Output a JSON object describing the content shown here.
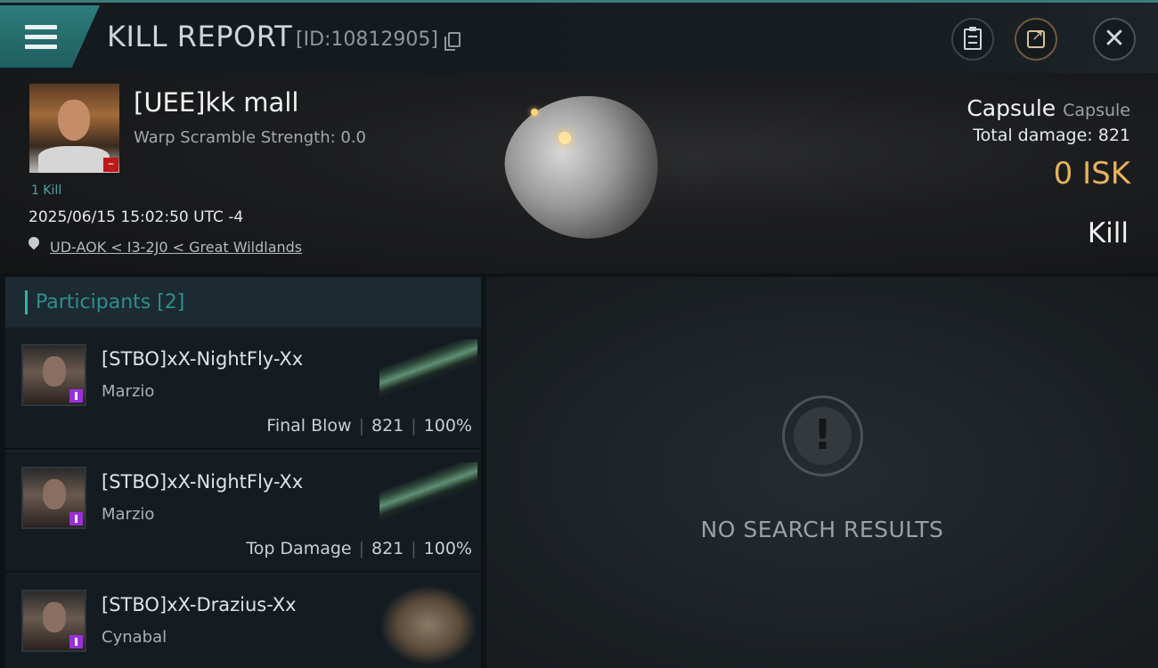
{
  "header": {
    "title": "KILL REPORT",
    "report_id": "[ID:10812905]"
  },
  "victim": {
    "name": "[UEE]kk mall",
    "warp_scramble": "Warp Scramble Strength: 0.0",
    "kill_count": "1 Kill",
    "timestamp": "2025/06/15 15:02:50 UTC -4",
    "location": "UD-AOK < I3-2J0 < Great Wildlands",
    "ship_type": "Capsule",
    "ship_class": "Capsule",
    "total_damage": "Total damage:  821",
    "isk_value": "0  ISK",
    "result": "Kill"
  },
  "participants": {
    "title": "Participants [2]",
    "items": [
      {
        "name": "[STBO]xX-NightFly-Xx",
        "corp": "Marzio",
        "role": "Final Blow",
        "damage": "821",
        "percent": "100%"
      },
      {
        "name": "[STBO]xX-NightFly-Xx",
        "corp": "Marzio",
        "role": "Top Damage",
        "damage": "821",
        "percent": "100%"
      },
      {
        "name": "[STBO]xX-Drazius-Xx",
        "corp": "Cynabal"
      }
    ]
  },
  "results": {
    "empty_text": "NO SEARCH RESULTS"
  },
  "colors": {
    "accent": "#3d7b7a",
    "isk": "#e6b45a",
    "security_badge": "#c01818",
    "participant_badge": "#9a2fd8"
  }
}
